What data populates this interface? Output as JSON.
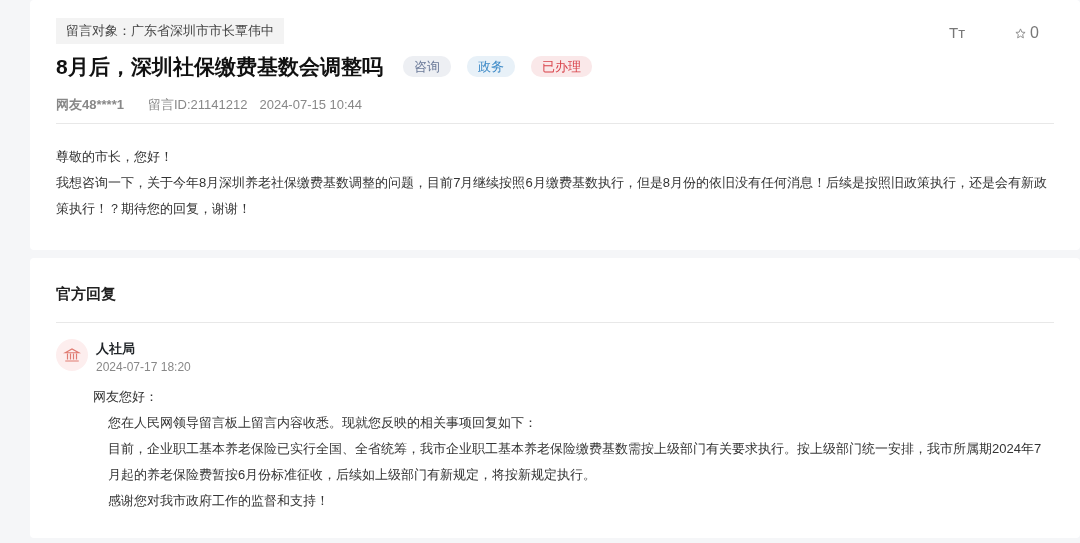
{
  "message": {
    "recipient": "留言对象：广东省深圳市市长覃伟中",
    "title": "8月后，深圳社保缴费基数会调整吗",
    "tags": [
      {
        "label": "咨询",
        "color": "#6b7a99"
      },
      {
        "label": "政务",
        "color": "#3d8ac7"
      },
      {
        "label": "已办理",
        "color": "#d9434b"
      }
    ],
    "font_toggle": "Tт",
    "favorites": "0",
    "author": "网友48****1",
    "message_id": "留言ID:21141212",
    "time": "2024-07-15 10:44",
    "paragraphs": [
      "尊敬的市长，您好！",
      "我想咨询一下，关于今年8月深圳养老社保缴费基数调整的问题，目前7月继续按照6月缴费基数执行，但是8月份的依旧没有任何消息！后续是按照旧政策执行，还是会有新政策执行！？期待您的回复，谢谢！"
    ]
  },
  "reply": {
    "heading": "官方回复",
    "department": "人社局",
    "time": "2024-07-17 18:20",
    "paragraphs": [
      {
        "kind": "greeting",
        "text": "网友您好："
      },
      {
        "kind": "body",
        "text": "您在人民网领导留言板上留言内容收悉。现就您反映的相关事项回复如下："
      },
      {
        "kind": "body",
        "text": "目前，企业职工基本养老保险已实行全国、全省统筹，我市企业职工基本养老保险缴费基数需按上级部门有关要求执行。按上级部门统一安排，我市所属期2024年7月起的养老保险费暂按6月份标准征收，后续如上级部门有新规定，将按新规定执行。"
      },
      {
        "kind": "body",
        "text": "感谢您对我市政府工作的监督和支持！"
      }
    ]
  }
}
